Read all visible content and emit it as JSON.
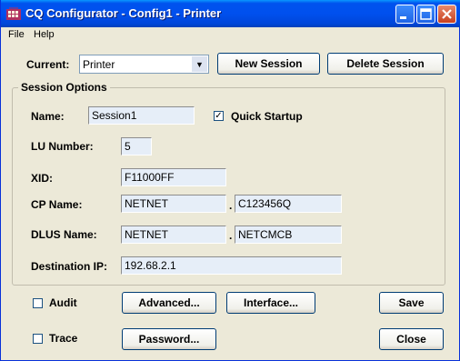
{
  "window": {
    "title": "CQ Configurator - Config1 - Printer",
    "controls": {
      "minimize": "minimize-icon",
      "maximize": "maximize-icon",
      "close": "close-icon"
    }
  },
  "menu": {
    "file": "File",
    "help": "Help"
  },
  "toolbar": {
    "current_label": "Current:",
    "current_value": "Printer",
    "new_session": "New Session",
    "delete_session": "Delete Session"
  },
  "session_options": {
    "title": "Session Options",
    "name_label": "Name:",
    "name_value": "Session1",
    "quick_startup_label": "Quick Startup",
    "quick_startup_checked": true,
    "lu_label": "LU Number:",
    "lu_value": "5",
    "xid_label": "XID:",
    "xid_value": "F11000FF",
    "cp_label": "CP Name:",
    "cp_network": "NETNET",
    "cp_name": "C123456Q",
    "dlus_label": "DLUS Name:",
    "dlus_network": "NETNET",
    "dlus_name": "NETCMCB",
    "dest_label": "Destination IP:",
    "dest_value": "192.68.2.1",
    "separator": "."
  },
  "bottom": {
    "audit_label": "Audit",
    "audit_checked": false,
    "trace_label": "Trace",
    "trace_checked": false,
    "advanced": "Advanced...",
    "interface": "Interface...",
    "password": "Password...",
    "save": "Save",
    "close": "Close"
  }
}
